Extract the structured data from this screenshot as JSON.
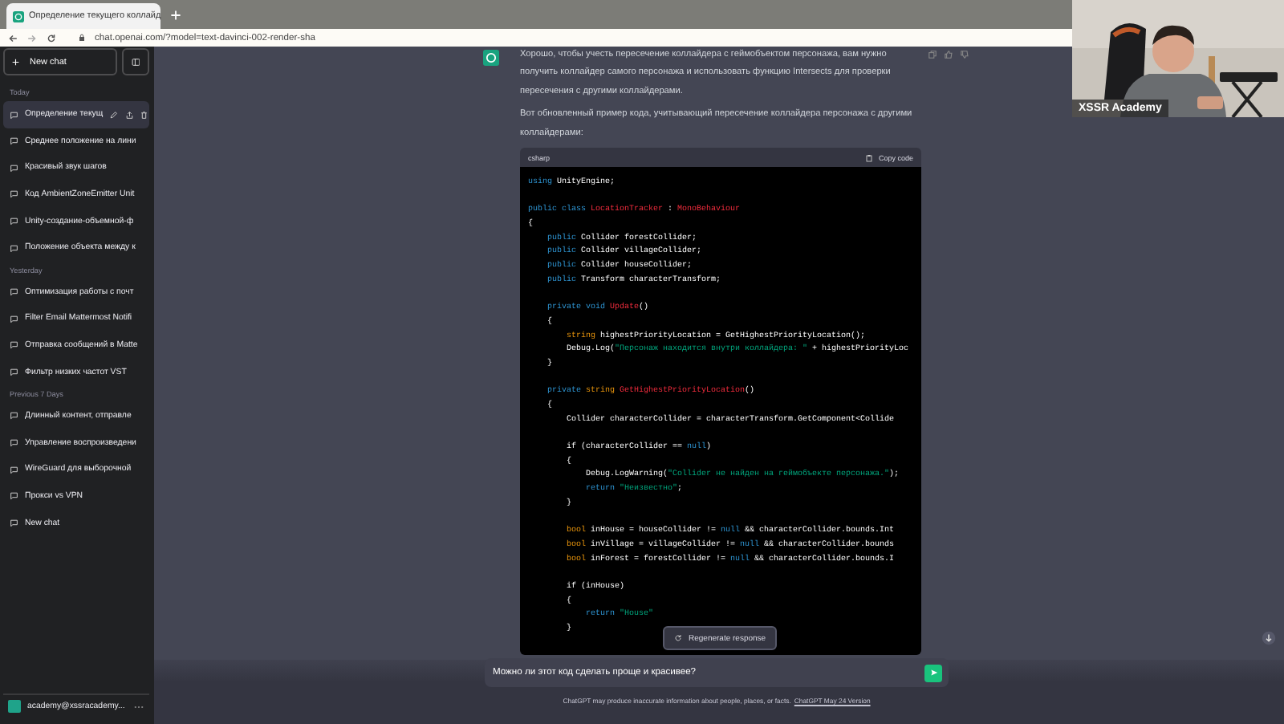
{
  "browser": {
    "tab": {
      "title": "Определение текущего коллайд"
    },
    "url": "chat.openai.com/?model=text-davinci-002-render-sha"
  },
  "sidebar": {
    "new_chat": "New chat",
    "groups": [
      {
        "label": "Today",
        "items": [
          {
            "title": "Определение текущ",
            "selected": true
          },
          {
            "title": "Среднее положение на лини",
            "selected": false
          },
          {
            "title": "Красивый звук шагов",
            "selected": false
          },
          {
            "title": "Код AmbientZoneEmitter Unit",
            "selected": false
          },
          {
            "title": "Unity-создание-объемной-ф",
            "selected": false
          },
          {
            "title": "Положение объекта между к",
            "selected": false
          }
        ]
      },
      {
        "label": "Yesterday",
        "items": [
          {
            "title": "Оптимизация работы с почт",
            "selected": false
          },
          {
            "title": "Filter Email Mattermost Notifi",
            "selected": false
          },
          {
            "title": "Отправка сообщений в Matte",
            "selected": false
          },
          {
            "title": "Фильтр низких частот VST",
            "selected": false
          }
        ]
      },
      {
        "label": "Previous 7 Days",
        "items": [
          {
            "title": "Длинный контент, отправле",
            "selected": false
          },
          {
            "title": "Управление воспроизведени",
            "selected": false
          },
          {
            "title": "WireGuard для выборочной",
            "selected": false
          },
          {
            "title": "Прокси vs VPN",
            "selected": false
          },
          {
            "title": "New chat",
            "selected": false
          }
        ]
      }
    ],
    "user": "academy@xssracademy..."
  },
  "message": {
    "paragraphs": [
      "Хорошо, чтобы учесть пересечение коллайдера с геймобъектом персонажа, вам нужно получить коллайдер самого персонажа и использовать функцию Intersects для проверки пересечения с другими коллайдерами.",
      "Вот обновленный пример кода, учитывающий пересечение коллайдера персонажа с другими коллайдерами:"
    ],
    "code": {
      "language": "csharp",
      "copy_label": "Copy code",
      "lines": [
        {
          "kind": "code",
          "tokens": [
            {
              "t": "using",
              "kind": "kw"
            },
            {
              "t": " UnityEngine;",
              "kind": "plain"
            }
          ]
        },
        {
          "kind": "blank"
        },
        {
          "kind": "code",
          "tokens": [
            {
              "t": "public class ",
              "kind": "kw"
            },
            {
              "t": "LocationTracker",
              "kind": "title"
            },
            {
              "t": " : ",
              "kind": "plain"
            },
            {
              "t": "MonoBehaviour",
              "kind": "title"
            }
          ]
        },
        {
          "kind": "code",
          "tokens": [
            {
              "t": "{",
              "kind": "plain"
            }
          ]
        },
        {
          "kind": "code",
          "tokens": [
            {
              "t": "    public",
              "kind": "kw"
            },
            {
              "t": " Collider forestCollider;",
              "kind": "plain"
            }
          ]
        },
        {
          "kind": "code",
          "tokens": [
            {
              "t": "    public",
              "kind": "kw"
            },
            {
              "t": " Collider villageCollider;",
              "kind": "plain"
            }
          ]
        },
        {
          "kind": "code",
          "tokens": [
            {
              "t": "    public",
              "kind": "kw"
            },
            {
              "t": " Collider houseCollider;",
              "kind": "plain"
            }
          ]
        },
        {
          "kind": "code",
          "tokens": [
            {
              "t": "    public",
              "kind": "kw"
            },
            {
              "t": " Transform characterTransform;",
              "kind": "plain"
            }
          ]
        },
        {
          "kind": "blank"
        },
        {
          "kind": "code",
          "tokens": [
            {
              "t": "    private void ",
              "kind": "kw"
            },
            {
              "t": "Update",
              "kind": "title"
            },
            {
              "t": "()",
              "kind": "plain"
            }
          ]
        },
        {
          "kind": "code",
          "tokens": [
            {
              "t": "    {",
              "kind": "plain"
            }
          ]
        },
        {
          "kind": "code",
          "tokens": [
            {
              "t": "        string",
              "kind": "type"
            },
            {
              "t": " highestPriorityLocation = GetHighestPriorityLocation();",
              "kind": "plain"
            }
          ]
        },
        {
          "kind": "code",
          "tokens": [
            {
              "t": "        Debug.Log(",
              "kind": "plain"
            },
            {
              "t": "\"Персонаж находится внутри коллайдера: \"",
              "kind": "str"
            },
            {
              "t": " + highestPriorityLoc",
              "kind": "plain"
            }
          ]
        },
        {
          "kind": "code",
          "tokens": [
            {
              "t": "    }",
              "kind": "plain"
            }
          ]
        },
        {
          "kind": "blank"
        },
        {
          "kind": "code",
          "tokens": [
            {
              "t": "    private ",
              "kind": "kw"
            },
            {
              "t": "string ",
              "kind": "type"
            },
            {
              "t": "GetHighestPriorityLocation",
              "kind": "title"
            },
            {
              "t": "()",
              "kind": "plain"
            }
          ]
        },
        {
          "kind": "code",
          "tokens": [
            {
              "t": "    {",
              "kind": "plain"
            }
          ]
        },
        {
          "kind": "code",
          "tokens": [
            {
              "t": "        Collider characterCollider = characterTransform.GetComponent<Collide",
              "kind": "plain"
            }
          ]
        },
        {
          "kind": "blank"
        },
        {
          "kind": "code",
          "tokens": [
            {
              "t": "        if (characterCollider == ",
              "kind": "plain"
            },
            {
              "t": "null",
              "kind": "kw"
            },
            {
              "t": ")",
              "kind": "plain"
            }
          ]
        },
        {
          "kind": "code",
          "tokens": [
            {
              "t": "        {",
              "kind": "plain"
            }
          ]
        },
        {
          "kind": "code",
          "tokens": [
            {
              "t": "            Debug.LogWarning(",
              "kind": "plain"
            },
            {
              "t": "\"Collider не найден на геймобъекте персонажа.\"",
              "kind": "str"
            },
            {
              "t": ");",
              "kind": "plain"
            }
          ]
        },
        {
          "kind": "code",
          "tokens": [
            {
              "t": "            return ",
              "kind": "kw"
            },
            {
              "t": "\"Неизвестно\"",
              "kind": "str"
            },
            {
              "t": ";",
              "kind": "plain"
            }
          ]
        },
        {
          "kind": "code",
          "tokens": [
            {
              "t": "        }",
              "kind": "plain"
            }
          ]
        },
        {
          "kind": "blank"
        },
        {
          "kind": "code",
          "tokens": [
            {
              "t": "        bool",
              "kind": "type"
            },
            {
              "t": " inHouse = houseCollider != ",
              "kind": "plain"
            },
            {
              "t": "null",
              "kind": "kw"
            },
            {
              "t": " && characterCollider.bounds.Int",
              "kind": "plain"
            }
          ]
        },
        {
          "kind": "code",
          "tokens": [
            {
              "t": "        bool",
              "kind": "type"
            },
            {
              "t": " inVillage = villageCollider != ",
              "kind": "plain"
            },
            {
              "t": "null",
              "kind": "kw"
            },
            {
              "t": " && characterCollider.bounds",
              "kind": "plain"
            }
          ]
        },
        {
          "kind": "code",
          "tokens": [
            {
              "t": "        bool",
              "kind": "type"
            },
            {
              "t": " inForest = forestCollider != ",
              "kind": "plain"
            },
            {
              "t": "null",
              "kind": "kw"
            },
            {
              "t": " && characterCollider.bounds.I",
              "kind": "plain"
            }
          ]
        },
        {
          "kind": "blank"
        },
        {
          "kind": "code",
          "tokens": [
            {
              "t": "        if (inHouse)",
              "kind": "plain"
            }
          ]
        },
        {
          "kind": "code",
          "tokens": [
            {
              "t": "        {",
              "kind": "plain"
            }
          ]
        },
        {
          "kind": "code",
          "tokens": [
            {
              "t": "            return ",
              "kind": "kw"
            },
            {
              "t": "\"House\"",
              "kind": "str"
            }
          ]
        },
        {
          "kind": "code",
          "tokens": [
            {
              "t": "        }",
              "kind": "plain"
            }
          ]
        }
      ]
    }
  },
  "regenerate": "Regenerate response",
  "composer": {
    "value": "Можно ли этот код сделать проще и красивее?"
  },
  "footer": {
    "text": "ChatGPT may produce inaccurate information about people, places, or facts.",
    "link": "ChatGPT May 24 Version"
  },
  "webcam": {
    "kind": "picture",
    "caption": "XSSR Academy"
  }
}
